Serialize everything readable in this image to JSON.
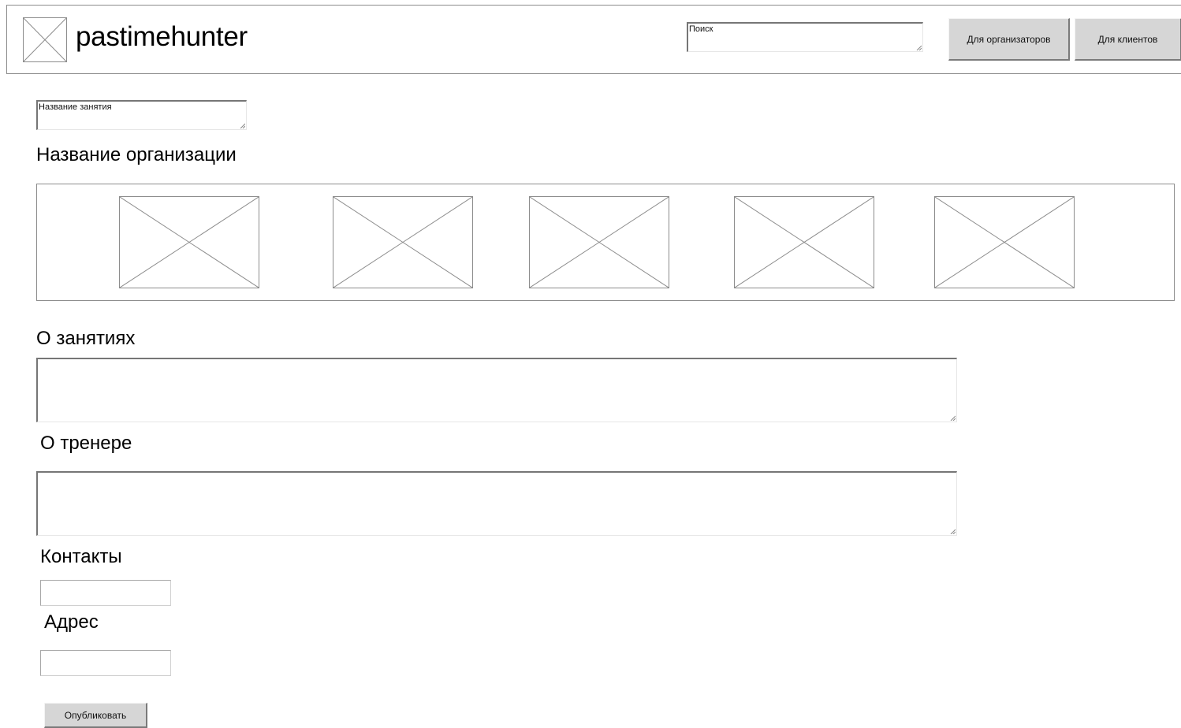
{
  "header": {
    "brand": "pastimehunter",
    "search_placeholder": "Поиск",
    "for_organizers_label": "Для организаторов",
    "for_clients_label": "Для клиентов"
  },
  "form": {
    "activity_name_placeholder": "Название занятия",
    "organization_name": "Название организации",
    "gallery_images": 5,
    "about_classes_label": "О занятиях",
    "about_trainer_label": "О тренере",
    "contacts_label": "Контакты",
    "address_label": "Адрес",
    "publish_label": "Опубликовать"
  },
  "colors": {
    "border": "#8c8c8c",
    "button_bg": "#d6d6d6",
    "background": "#ffffff"
  },
  "icons": {
    "logo": "image-placeholder-icon",
    "gallery_item": "image-placeholder-icon"
  }
}
